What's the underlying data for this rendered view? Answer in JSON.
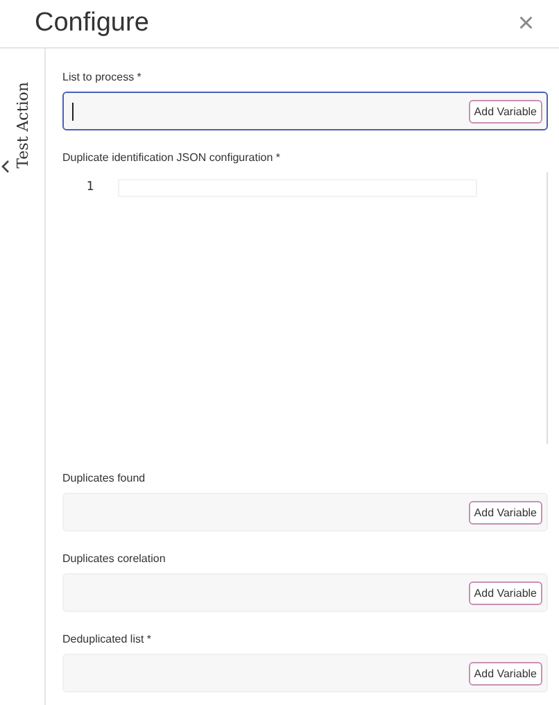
{
  "dialog": {
    "title": "Configure",
    "close": "×"
  },
  "sidebar": {
    "label": "Test Action"
  },
  "fields": [
    {
      "kind": "input",
      "label": "List to process *",
      "focused": true,
      "button": "Add Variable"
    },
    {
      "kind": "code",
      "label": "Duplicate identification JSON configuration *",
      "line_numbers": [
        "1"
      ]
    },
    {
      "kind": "input",
      "label": "Duplicates found",
      "focused": false,
      "button": "Add Variable"
    },
    {
      "kind": "input",
      "label": "Duplicates corelation",
      "focused": false,
      "button": "Add Variable"
    },
    {
      "kind": "input",
      "label": "Deduplicated list *",
      "focused": false,
      "button": "Add Variable"
    }
  ]
}
